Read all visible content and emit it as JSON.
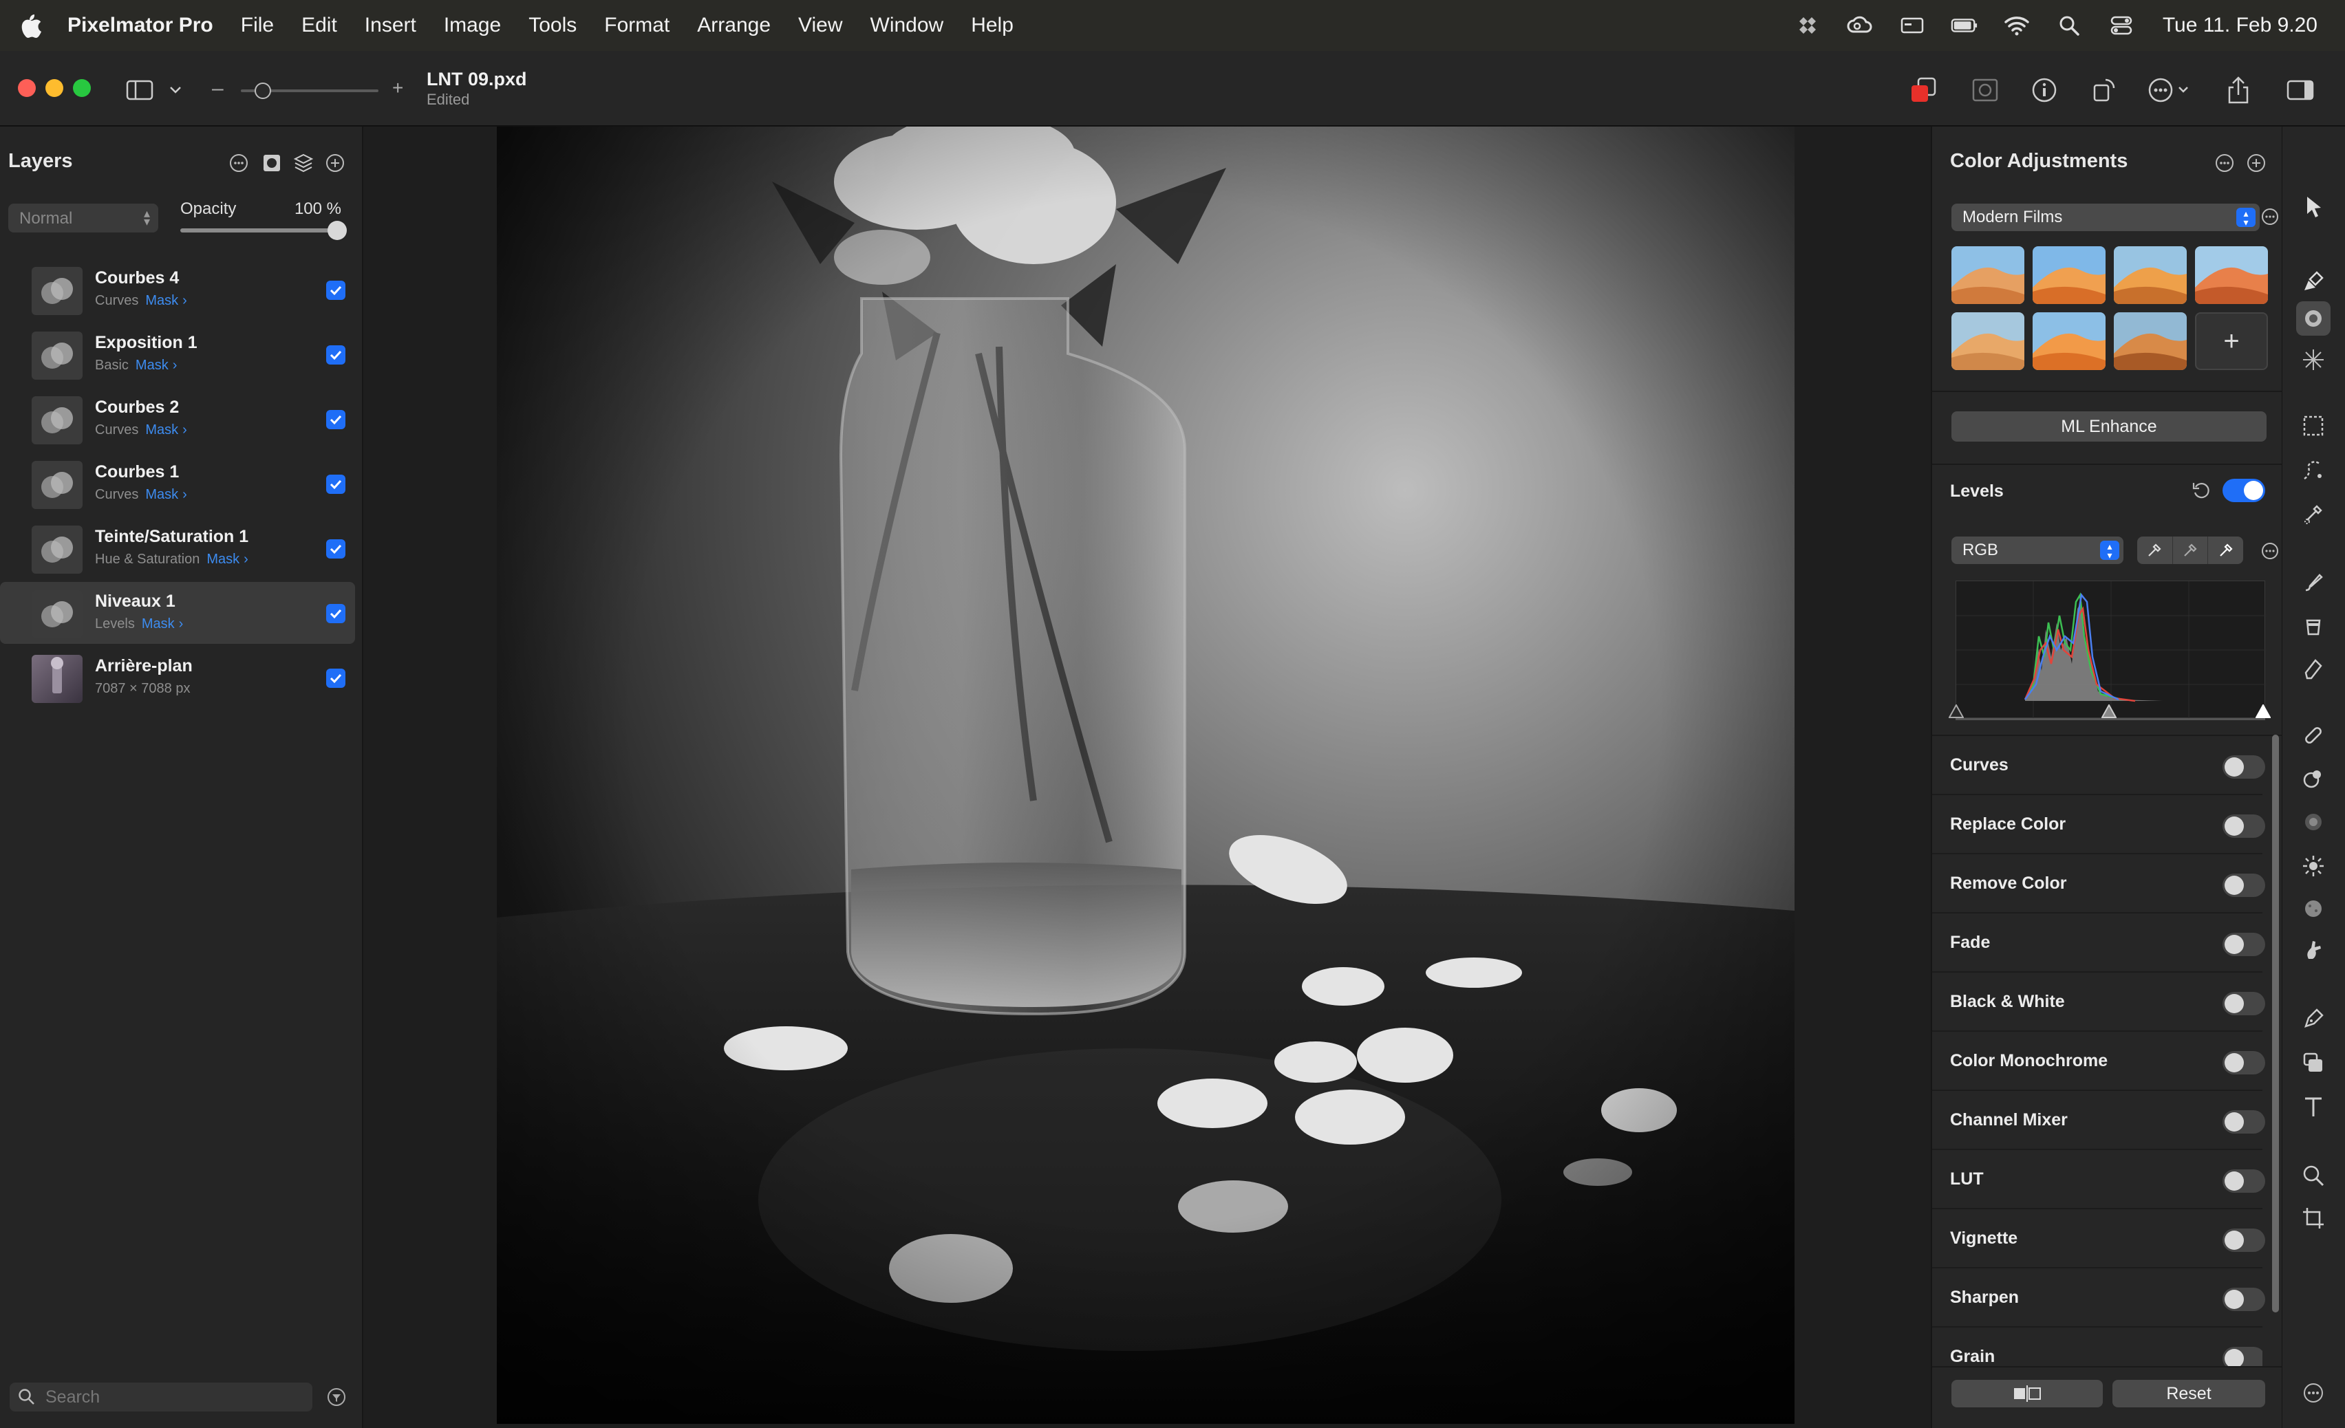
{
  "menubar": {
    "app_name": "Pixelmator Pro",
    "items": [
      "File",
      "Edit",
      "Insert",
      "Image",
      "Tools",
      "Format",
      "Arrange",
      "View",
      "Window",
      "Help"
    ],
    "clock": "Tue 11. Feb 9.20"
  },
  "toolbar": {
    "document_title": "LNT 09.pxd",
    "document_status": "Edited",
    "zoom_minus": "–",
    "zoom_plus": "+"
  },
  "layers_panel": {
    "title": "Layers",
    "blend_mode": "Normal",
    "opacity_label": "Opacity",
    "opacity_value": "100 %",
    "opacity_fraction": 1.0,
    "layers": [
      {
        "name": "Courbes 4",
        "type": "Curves",
        "mask": "Mask",
        "visible": true,
        "selected": false
      },
      {
        "name": "Exposition 1",
        "type": "Basic",
        "mask": "Mask",
        "visible": true,
        "selected": false
      },
      {
        "name": "Courbes 2",
        "type": "Curves",
        "mask": "Mask",
        "visible": true,
        "selected": false
      },
      {
        "name": "Courbes 1",
        "type": "Curves",
        "mask": "Mask",
        "visible": true,
        "selected": false
      },
      {
        "name": "Teinte/Saturation 1",
        "type": "Hue & Saturation",
        "mask": "Mask",
        "visible": true,
        "selected": false
      },
      {
        "name": "Niveaux 1",
        "type": "Levels",
        "mask": "Mask",
        "visible": true,
        "selected": true
      },
      {
        "name": "Arrière-plan",
        "type": "7087 × 7088 px",
        "mask": "",
        "visible": true,
        "selected": false
      }
    ],
    "search_placeholder": "Search"
  },
  "adjustments_panel": {
    "title": "Color Adjustments",
    "preset_collection": "Modern Films",
    "preset_add": "+",
    "ml_enhance": "ML Enhance",
    "levels": {
      "label": "Levels",
      "enabled": true,
      "channel": "RGB"
    },
    "adjustments": [
      {
        "label": "Curves",
        "enabled": false
      },
      {
        "label": "Replace Color",
        "enabled": false
      },
      {
        "label": "Remove Color",
        "enabled": false
      },
      {
        "label": "Fade",
        "enabled": false
      },
      {
        "label": "Black & White",
        "enabled": false
      },
      {
        "label": "Color Monochrome",
        "enabled": false
      },
      {
        "label": "Channel Mixer",
        "enabled": false
      },
      {
        "label": "LUT",
        "enabled": false
      },
      {
        "label": "Vignette",
        "enabled": false
      },
      {
        "label": "Sharpen",
        "enabled": false
      },
      {
        "label": "Grain",
        "enabled": false
      }
    ],
    "reset_label": "Reset"
  },
  "colors": {
    "accent": "#1f6ef7",
    "mask_link": "#3d8cf0",
    "close": "#fe5f57",
    "minimize": "#febc2e",
    "zoom": "#28c840"
  }
}
